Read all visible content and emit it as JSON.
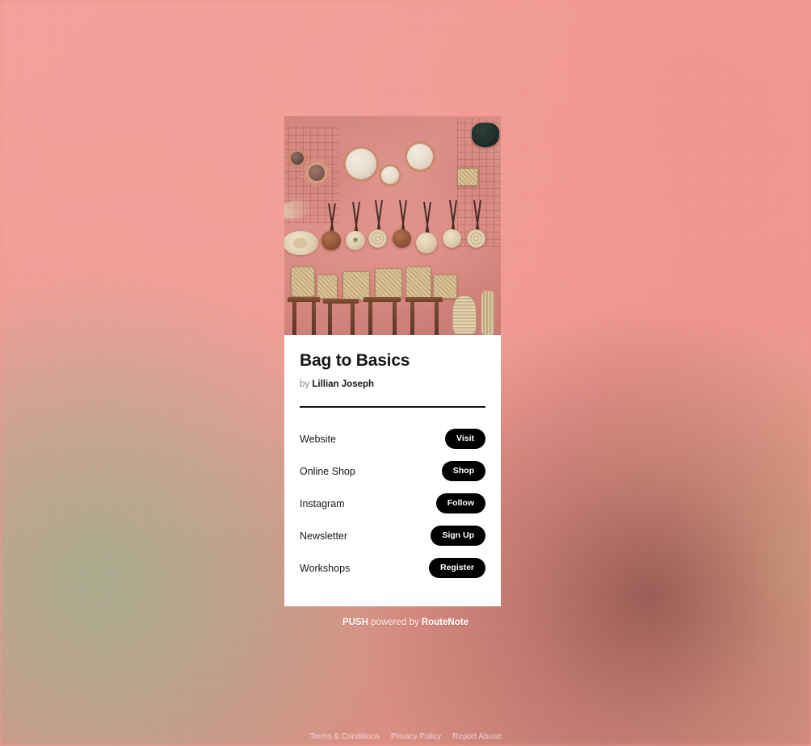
{
  "page": {
    "background_color": "#f0948d"
  },
  "card": {
    "hero": {
      "alt": "pink market wall with woven straw bags and round mirrors"
    },
    "title": "Bag to Basics",
    "byline": {
      "prefix": "by",
      "author": "Lillian Joseph"
    },
    "links": [
      {
        "label": "Website",
        "action": "Visit"
      },
      {
        "label": "Online Shop",
        "action": "Shop"
      },
      {
        "label": "Instagram",
        "action": "Follow"
      },
      {
        "label": "Newsletter",
        "action": "Sign Up"
      },
      {
        "label": "Workshops",
        "action": "Register"
      }
    ]
  },
  "brand": {
    "name": "PUSH",
    "middle": " powered by ",
    "provider": "RouteNote"
  },
  "legal": {
    "links": [
      {
        "label": "Terms & Conditions"
      },
      {
        "label": "Privacy Policy"
      },
      {
        "label": "Report Abuse"
      }
    ]
  }
}
